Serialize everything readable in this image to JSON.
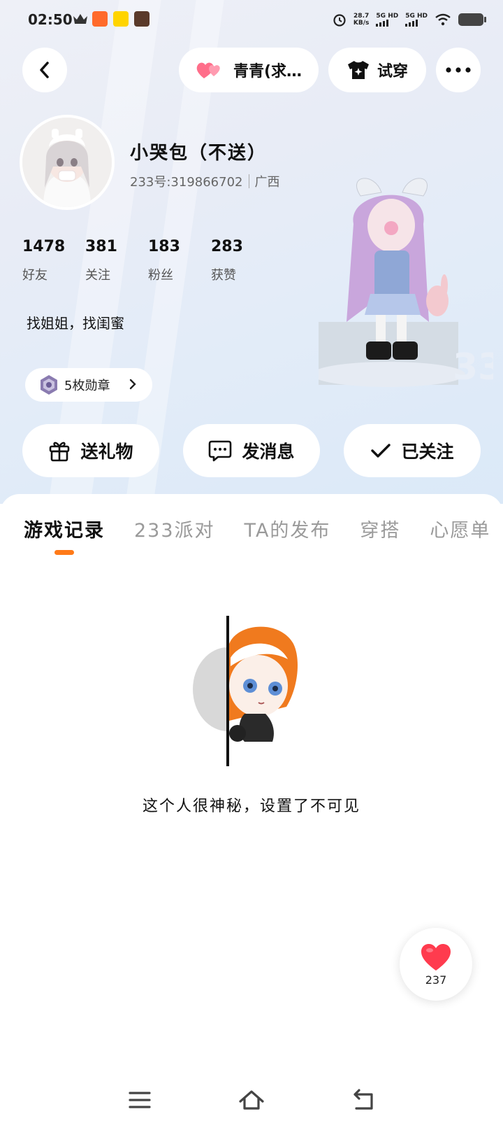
{
  "status_bar": {
    "time": "02:50",
    "net_speed_value": "28.7",
    "net_speed_unit": "KB/s",
    "sim1_label": "5G HD",
    "sim2_label": "5G HD",
    "icons": [
      "crown-icon",
      "app-icon-1",
      "app-icon-2",
      "app-icon-3",
      "alarm-icon",
      "wifi-icon",
      "battery-icon"
    ]
  },
  "header": {
    "back_icon": "chevron-left-icon",
    "cp_label": "青青(求…",
    "cp_icon": "hearts-icon",
    "try_on_label": "试穿",
    "try_on_icon": "tshirt-icon",
    "more_icon": "more-dots-icon"
  },
  "profile": {
    "nickname": "小哭包（不送）",
    "uid": "233号:319866702",
    "region": "广西",
    "stats": [
      {
        "value": "1478",
        "label": "好友"
      },
      {
        "value": "381",
        "label": "关注"
      },
      {
        "value": "183",
        "label": "粉丝"
      },
      {
        "value": "283",
        "label": "获赞"
      }
    ],
    "bio": "找姐姐，找闺蜜",
    "badges_label": "5枚勋章"
  },
  "actions": {
    "gift_label": "送礼物",
    "message_label": "发消息",
    "followed_label": "已关注"
  },
  "tabs": [
    {
      "label": "游戏记录",
      "active": true
    },
    {
      "label": "233派对",
      "active": false
    },
    {
      "label": "TA的发布",
      "active": false
    },
    {
      "label": "穿搭",
      "active": false
    },
    {
      "label": "心愿单",
      "active": false
    }
  ],
  "empty_state": {
    "message": "这个人很神秘，设置了不可见"
  },
  "like_fab": {
    "count": "237"
  },
  "colors": {
    "accent": "#ff7a18",
    "heart": "#ff3b4e",
    "text": "#111111",
    "muted": "#9a9a9a"
  }
}
